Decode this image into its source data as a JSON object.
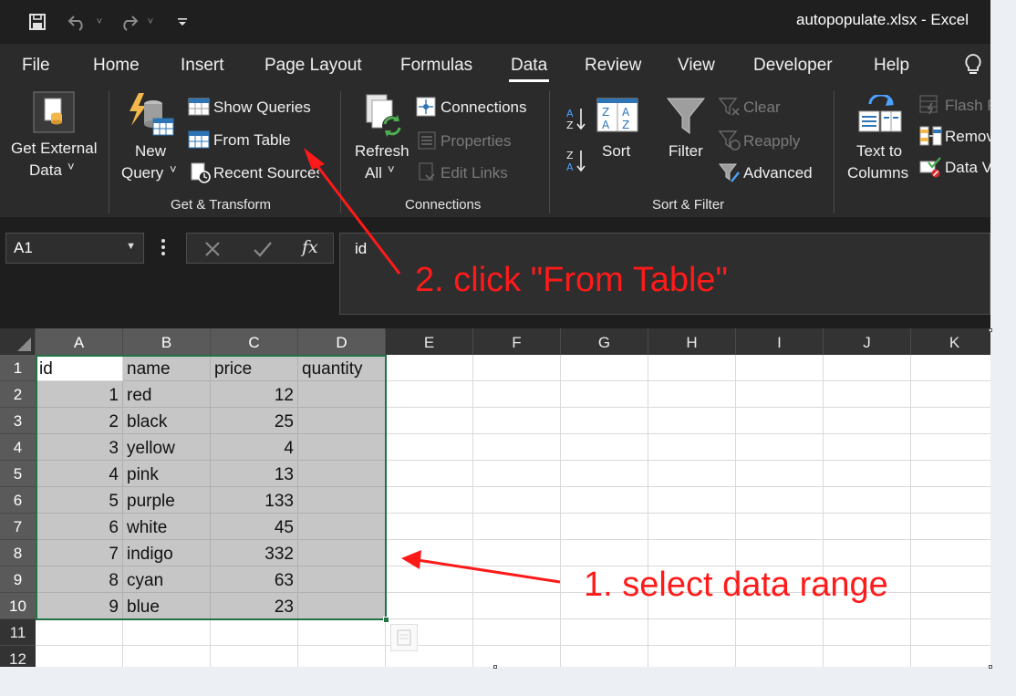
{
  "window": {
    "title": "autopopulate.xlsx  -  Excel"
  },
  "tabs": [
    {
      "label": "File",
      "active": false
    },
    {
      "label": "Home",
      "active": false
    },
    {
      "label": "Insert",
      "active": false
    },
    {
      "label": "Page Layout",
      "active": false
    },
    {
      "label": "Formulas",
      "active": false
    },
    {
      "label": "Data",
      "active": true
    },
    {
      "label": "Review",
      "active": false
    },
    {
      "label": "View",
      "active": false
    },
    {
      "label": "Developer",
      "active": false
    },
    {
      "label": "Help",
      "active": false
    }
  ],
  "ribbon": {
    "get_external_data": {
      "line1": "Get External",
      "line2": "Data",
      "chev": "˅"
    },
    "new_query": {
      "line1": "New",
      "line2": "Query",
      "chev": "˅"
    },
    "show_queries": "Show Queries",
    "from_table": "From Table",
    "recent_sources": "Recent Sources",
    "group_get_transform": "Get & Transform",
    "refresh_all": {
      "line1": "Refresh",
      "line2": "All",
      "chev": "˅"
    },
    "connections": "Connections",
    "properties": "Properties",
    "edit_links": "Edit Links",
    "group_connections": "Connections",
    "sort": "Sort",
    "filter": "Filter",
    "clear": "Clear",
    "reapply": "Reapply",
    "advanced": "Advanced",
    "group_sort_filter": "Sort & Filter",
    "text_to_columns": {
      "line1": "Text to",
      "line2": "Columns"
    },
    "flash_fill": "Flash F",
    "remove_duplicates": "Remov",
    "data_validation": "Data V"
  },
  "formula_bar": {
    "name_box": "A1",
    "fx": "fx",
    "content": "id"
  },
  "sheet": {
    "columns": [
      "A",
      "B",
      "C",
      "D",
      "E",
      "F",
      "G",
      "H",
      "I",
      "J",
      "K"
    ],
    "rows": [
      "1",
      "2",
      "3",
      "4",
      "5",
      "6",
      "7",
      "8",
      "9",
      "10",
      "11",
      "12"
    ],
    "header": [
      "id",
      "name",
      "price",
      "quantity"
    ],
    "data": [
      [
        "1",
        "red",
        "12",
        ""
      ],
      [
        "2",
        "black",
        "25",
        ""
      ],
      [
        "3",
        "yellow",
        "4",
        ""
      ],
      [
        "4",
        "pink",
        "13",
        ""
      ],
      [
        "5",
        "purple",
        "133",
        ""
      ],
      [
        "6",
        "white",
        "45",
        ""
      ],
      [
        "7",
        "indigo",
        "332",
        ""
      ],
      [
        "8",
        "cyan",
        "63",
        ""
      ],
      [
        "9",
        "blue",
        "23",
        ""
      ]
    ]
  },
  "annotations": {
    "step1": "1. select data range",
    "step2": "2. click \"From Table\""
  },
  "colors": {
    "accent": "#217346",
    "annotation": "#ff1a1a",
    "selection": "#c6c6c6"
  }
}
